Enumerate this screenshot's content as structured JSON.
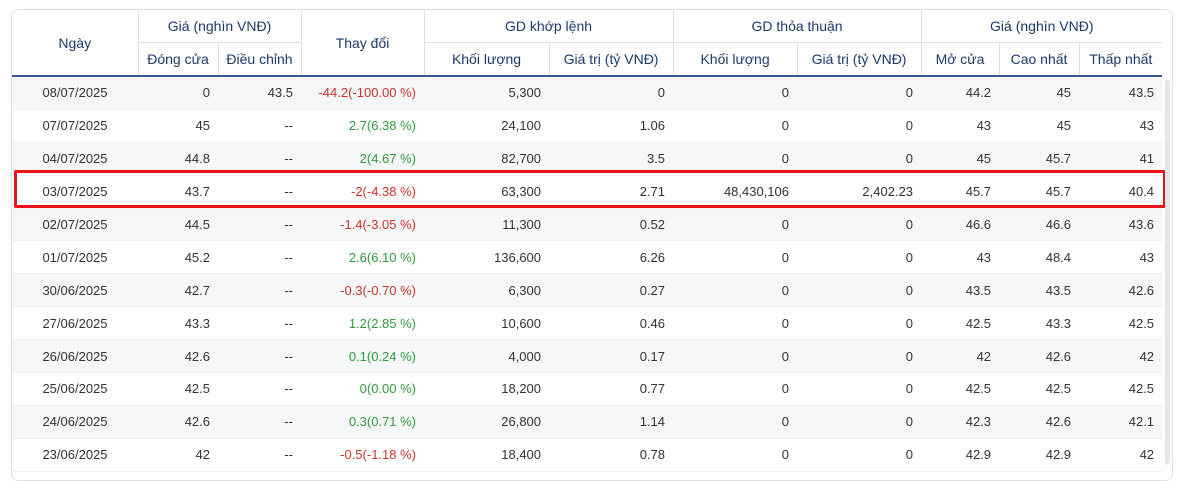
{
  "headers": {
    "date": "Ngày",
    "price_group": "Giá (nghìn VNĐ)",
    "close": "Đóng cửa",
    "adjusted": "Điều chỉnh",
    "change": "Thay đổi",
    "matched_group": "GD khớp lệnh",
    "matched_volume": "Khối lượng",
    "matched_value": "Giá trị (tỷ VNĐ)",
    "negotiated_group": "GD thỏa thuận",
    "negotiated_volume": "Khối lượng",
    "negotiated_value": "Giá trị (tỷ VNĐ)",
    "price_group2": "Giá (nghìn VNĐ)",
    "open": "Mở cửa",
    "high": "Cao nhất",
    "low": "Thấp nhất"
  },
  "colors": {
    "up": "#2e9c3c",
    "down": "#d0312d",
    "highlight": "#e8141a",
    "header_text": "#1a3a6b"
  },
  "highlighted_row": 3,
  "rows": [
    {
      "date": "08/07/2025",
      "close": "0",
      "adjusted": "43.5",
      "change": "-44.2(-100.00 %)",
      "dir": "down",
      "mvol": "5,300",
      "mval": "0",
      "nvol": "0",
      "nval": "0",
      "open": "44.2",
      "high": "45",
      "low": "43.5"
    },
    {
      "date": "07/07/2025",
      "close": "45",
      "adjusted": "--",
      "change": "2.7(6.38 %)",
      "dir": "up",
      "mvol": "24,100",
      "mval": "1.06",
      "nvol": "0",
      "nval": "0",
      "open": "43",
      "high": "45",
      "low": "43"
    },
    {
      "date": "04/07/2025",
      "close": "44.8",
      "adjusted": "--",
      "change": "2(4.67 %)",
      "dir": "up",
      "mvol": "82,700",
      "mval": "3.5",
      "nvol": "0",
      "nval": "0",
      "open": "45",
      "high": "45.7",
      "low": "41"
    },
    {
      "date": "03/07/2025",
      "close": "43.7",
      "adjusted": "--",
      "change": "-2(-4.38 %)",
      "dir": "down",
      "mvol": "63,300",
      "mval": "2.71",
      "nvol": "48,430,106",
      "nval": "2,402.23",
      "open": "45.7",
      "high": "45.7",
      "low": "40.4"
    },
    {
      "date": "02/07/2025",
      "close": "44.5",
      "adjusted": "--",
      "change": "-1.4(-3.05 %)",
      "dir": "down",
      "mvol": "11,300",
      "mval": "0.52",
      "nvol": "0",
      "nval": "0",
      "open": "46.6",
      "high": "46.6",
      "low": "43.6"
    },
    {
      "date": "01/07/2025",
      "close": "45.2",
      "adjusted": "--",
      "change": "2.6(6.10 %)",
      "dir": "up",
      "mvol": "136,600",
      "mval": "6.26",
      "nvol": "0",
      "nval": "0",
      "open": "43",
      "high": "48.4",
      "low": "43"
    },
    {
      "date": "30/06/2025",
      "close": "42.7",
      "adjusted": "--",
      "change": "-0.3(-0.70 %)",
      "dir": "down",
      "mvol": "6,300",
      "mval": "0.27",
      "nvol": "0",
      "nval": "0",
      "open": "43.5",
      "high": "43.5",
      "low": "42.6"
    },
    {
      "date": "27/06/2025",
      "close": "43.3",
      "adjusted": "--",
      "change": "1.2(2.85 %)",
      "dir": "up",
      "mvol": "10,600",
      "mval": "0.46",
      "nvol": "0",
      "nval": "0",
      "open": "42.5",
      "high": "43.3",
      "low": "42.5"
    },
    {
      "date": "26/06/2025",
      "close": "42.6",
      "adjusted": "--",
      "change": "0.1(0.24 %)",
      "dir": "up",
      "mvol": "4,000",
      "mval": "0.17",
      "nvol": "0",
      "nval": "0",
      "open": "42",
      "high": "42.6",
      "low": "42"
    },
    {
      "date": "25/06/2025",
      "close": "42.5",
      "adjusted": "--",
      "change": "0(0.00 %)",
      "dir": "up",
      "mvol": "18,200",
      "mval": "0.77",
      "nvol": "0",
      "nval": "0",
      "open": "42.5",
      "high": "42.5",
      "low": "42.5"
    },
    {
      "date": "24/06/2025",
      "close": "42.6",
      "adjusted": "--",
      "change": "0.3(0.71 %)",
      "dir": "up",
      "mvol": "26,800",
      "mval": "1.14",
      "nvol": "0",
      "nval": "0",
      "open": "42.3",
      "high": "42.6",
      "low": "42.1"
    },
    {
      "date": "23/06/2025",
      "close": "42",
      "adjusted": "--",
      "change": "-0.5(-1.18 %)",
      "dir": "down",
      "mvol": "18,400",
      "mval": "0.78",
      "nvol": "0",
      "nval": "0",
      "open": "42.9",
      "high": "42.9",
      "low": "42"
    }
  ]
}
